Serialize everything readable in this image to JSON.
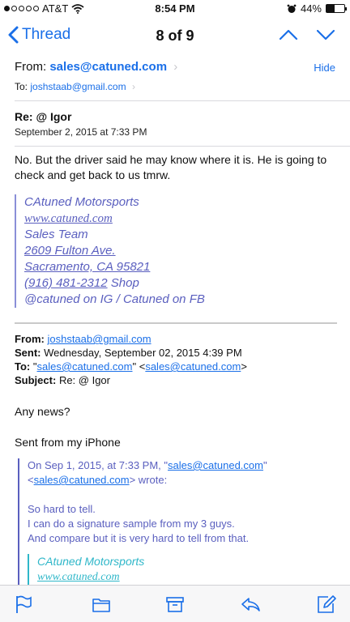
{
  "status": {
    "carrier": "AT&T",
    "time": "8:54 PM",
    "battery": "44%",
    "battery_level": 0.44
  },
  "nav": {
    "back_label": "Thread",
    "position": "8 of 9"
  },
  "header": {
    "from_label": "From:",
    "from_addr": "sales@catuned.com",
    "hide_label": "Hide",
    "to_label": "To:",
    "to_addr": "joshstaab@gmail.com",
    "subject": "Re: @ Igor",
    "date": "September 2, 2015 at 7:33 PM"
  },
  "body": "No. But the driver said he may know where it is. He is going to check and get back to us tmrw.",
  "signature": {
    "company": "CAtuned Motorsports",
    "site": "www.catuned.com",
    "team": "Sales Team",
    "street": "2609 Fulton Ave.",
    "city": "Sacramento, CA 95821",
    "phone": "(916) 481-2312",
    "phone_suffix": "Shop",
    "social": "@catuned on IG / Catuned on FB"
  },
  "quoted": {
    "from_label": "From",
    "from": "joshstaab@gmail.com",
    "sent_label": "Sent",
    "sent": "Wednesday, September 02, 2015 4:39 PM",
    "to_label": "To",
    "to_q_open": "\"",
    "to_name": "sales@catuned.com",
    "to_q_mid": "\" <",
    "to_addr": "sales@catuned.com",
    "to_q_close": ">",
    "subject_label": "Subject",
    "subject": "Re: @ Igor",
    "any_news": "Any news?",
    "sent_from": "Sent from my iPhone"
  },
  "quoted2": {
    "on_prefix": "On Sep 1, 2015, at 7:33 PM, \"",
    "name": "sales@catuned.com",
    "name_suffix": "\"",
    "addr_open": "<",
    "addr": "sales@catuned.com",
    "wrote": "> wrote:",
    "line1": "So hard to tell.",
    "line2": "I can do a signature sample from my 3 guys.",
    "line3": "And compare but it is very hard to tell from that.",
    "sig_company": "CAtuned Motorsports",
    "sig_site": "www.catuned.com"
  },
  "toolbar": {
    "icons": [
      "flag-icon",
      "folder-icon",
      "archive-icon",
      "reply-icon",
      "compose-icon"
    ]
  },
  "colors": {
    "accent": "#1a6fe8",
    "quote": "#5a5fbf",
    "quote_inner": "#2fb7c9"
  }
}
